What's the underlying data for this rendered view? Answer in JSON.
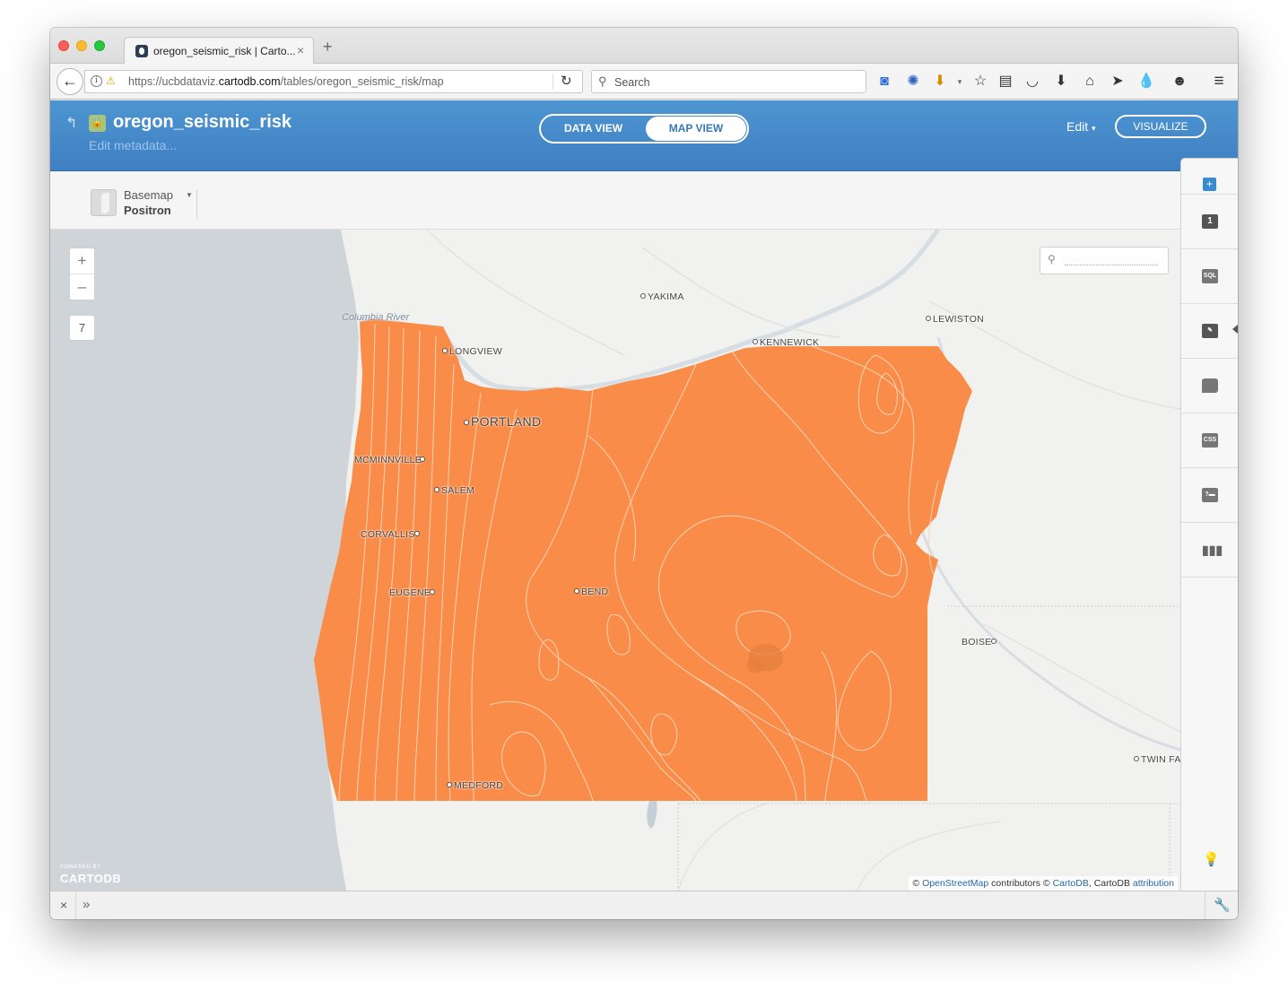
{
  "browser": {
    "tab_title": "oregon_seismic_risk | Carto...",
    "new_tab_symbol": "+",
    "url_prefix": "https://ucbdataviz.",
    "url_domain": "cartodb.com",
    "url_path": "/tables/oregon_seismic_risk/map",
    "search_placeholder": "Search",
    "toolbar_icons": [
      "database-icon",
      "extension-icon",
      "downloader-icon",
      "bookmark-star-icon",
      "reading-list-icon",
      "pocket-icon",
      "download-icon",
      "home-icon",
      "send-icon",
      "droplet-icon",
      "emoji-icon",
      "hamburger-menu-icon"
    ]
  },
  "header": {
    "title": "oregon_seismic_risk",
    "metadata_link": "Edit metadata...",
    "views": [
      "DATA VIEW",
      "MAP VIEW"
    ],
    "active_view": "MAP VIEW",
    "edit_label": "Edit",
    "visualize_label": "VISUALIZE"
  },
  "basemap": {
    "label": "Basemap",
    "value": "Positron"
  },
  "map": {
    "zoom_in": "+",
    "zoom_out": "–",
    "zoom_level": "7",
    "river_label": "Columbia River",
    "cities": [
      "YAKIMA",
      "LEWISTON",
      "KENNEWICK",
      "LONGVIEW",
      "PORTLAND",
      "MCMINNVILLE",
      "SALEM",
      "CORVALLIS",
      "EUGENE",
      "BEND",
      "BOISE",
      "TWIN FA",
      "MEDFORD"
    ],
    "powered_by": "POWERED BY",
    "logo_text": "CARTODB",
    "attribution": {
      "prefix": "© ",
      "osm": "OpenStreetMap",
      "middle": " contributors © ",
      "cartodb": "CartoDB",
      "tail": ", CartoDB ",
      "attr_link": "attribution"
    },
    "fill_color": "#f98c48",
    "contour_color": "#fdd3b5"
  },
  "sidebar": {
    "add_layer": "+",
    "layer_number": "1",
    "tools": [
      "SQL",
      "wizard",
      "infowindow",
      "CSS",
      "legend",
      "filters"
    ],
    "sql_label": "SQL",
    "css_label": "CSS"
  }
}
